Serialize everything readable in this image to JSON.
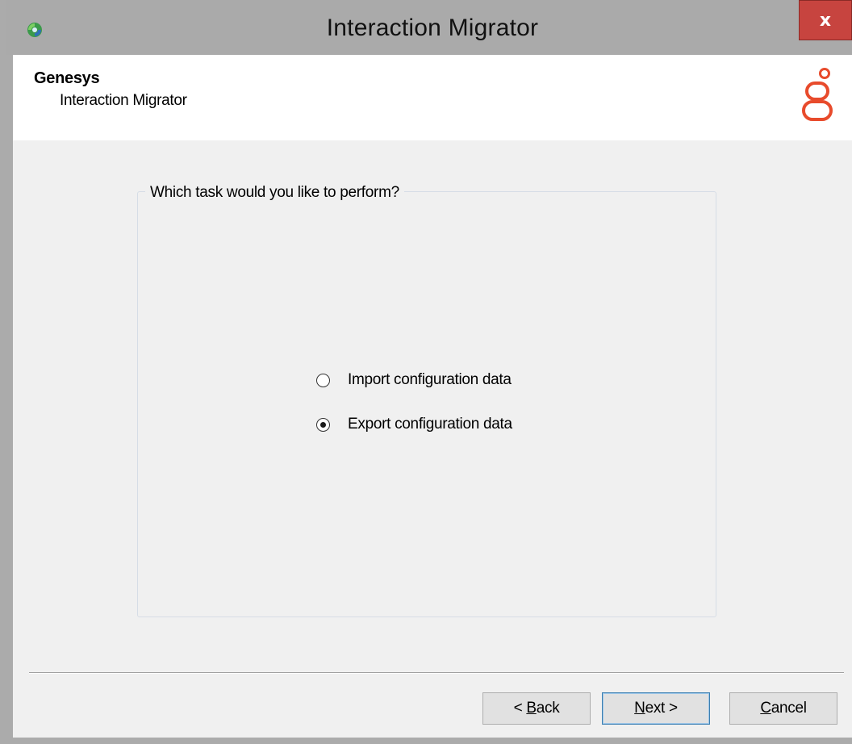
{
  "window": {
    "title": "Interaction Migrator",
    "close_label": "x"
  },
  "header": {
    "title": "Genesys",
    "subtitle": "Interaction Migrator"
  },
  "group": {
    "legend": "Which task would you like to perform?"
  },
  "options": [
    {
      "label": "Import configuration data",
      "checked": false
    },
    {
      "label": "Export configuration data",
      "checked": true
    }
  ],
  "buttons": {
    "back": {
      "prefix": "< ",
      "mnemonic": "B",
      "rest": "ack"
    },
    "next": {
      "mnemonic": "N",
      "rest": "ext >"
    },
    "cancel": {
      "mnemonic": "C",
      "rest": "ancel"
    }
  },
  "colors": {
    "close_button": "#c7443f",
    "logo": "#e84b2c",
    "window_frame": "#ababab",
    "client_bg": "#f0f0f0"
  },
  "icons": {
    "app": "app-icon",
    "logo": "genesys-logo-icon"
  }
}
